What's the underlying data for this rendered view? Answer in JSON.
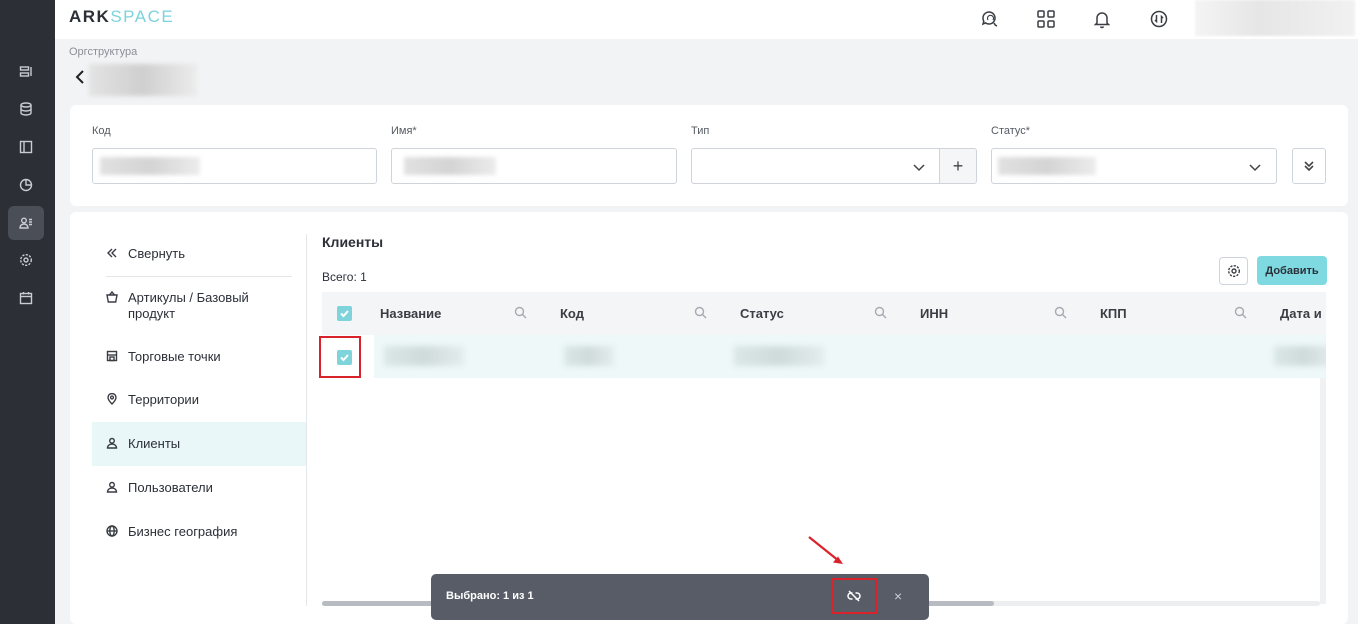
{
  "app": {
    "logo_part1": "ARK",
    "logo_part2": "SPACE"
  },
  "topbar": {
    "icons": [
      "support-chat-icon",
      "apps-grid-icon",
      "bell-icon",
      "sync-icon"
    ]
  },
  "rail": {
    "items": [
      "list-icon",
      "database-icon",
      "layout-icon",
      "chart-icon",
      "users-icon",
      "gear-icon",
      "calendar-icon"
    ],
    "active_index": 4
  },
  "breadcrumb": "Оргструктура",
  "form": {
    "code_label": "Код",
    "name_label": "Имя*",
    "type_label": "Тип",
    "status_label": "Статус*"
  },
  "sidebar": {
    "collapse": "Свернуть",
    "items": [
      {
        "label": "Артикулы / Базовый продукт",
        "icon": "basket-icon"
      },
      {
        "label": "Торговые точки",
        "icon": "store-icon"
      },
      {
        "label": "Территории",
        "icon": "map-pin-icon"
      },
      {
        "label": "Клиенты",
        "icon": "user-icon"
      },
      {
        "label": "Пользователи",
        "icon": "user-icon"
      },
      {
        "label": "Бизнес география",
        "icon": "globe-icon"
      }
    ],
    "active_index": 3
  },
  "section": {
    "title": "Клиенты",
    "total": "Всего: 1",
    "add_button": "Добавить"
  },
  "table": {
    "columns": [
      "Название",
      "Код",
      "Статус",
      "ИНН",
      "КПП",
      "Дата и"
    ]
  },
  "toast": {
    "text": "Выбрано: 1 из 1",
    "close": "×"
  },
  "colors": {
    "accent": "#7fd9e0",
    "highlight": "#d9222a",
    "rail": "#2c2f36"
  }
}
